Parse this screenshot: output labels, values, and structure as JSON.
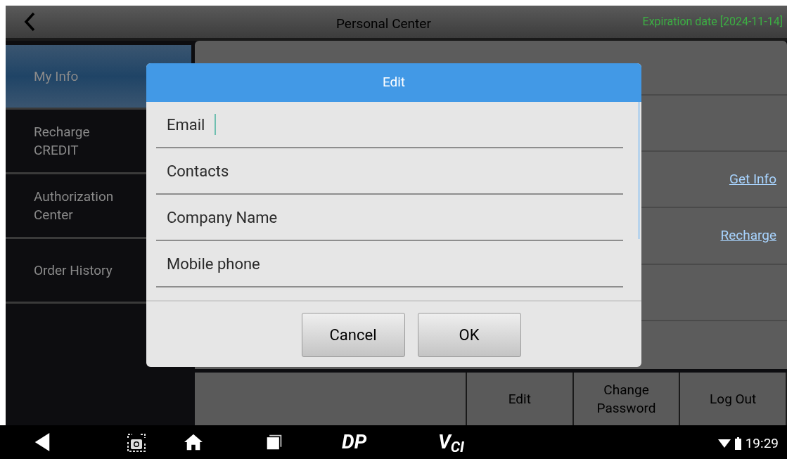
{
  "top_bar": {
    "title": "Personal Center",
    "expiration": "Expiration date [2024-11-14]"
  },
  "sidebar": {
    "items": [
      {
        "label": "My Info",
        "selected": true
      },
      {
        "label": "Recharge\nCREDIT",
        "selected": false
      },
      {
        "label": "Authorization\nCenter",
        "selected": false
      },
      {
        "label": "Order History",
        "selected": false
      }
    ]
  },
  "content": {
    "links": [
      {
        "label": "Get Info"
      },
      {
        "label": "Recharge"
      }
    ]
  },
  "bottom_buttons": [
    "Edit",
    "Change\nPassword",
    "Log Out"
  ],
  "dialog": {
    "title": "Edit",
    "fields": [
      {
        "label": "Email",
        "focused": true
      },
      {
        "label": "Contacts",
        "focused": false
      },
      {
        "label": "Company Name",
        "focused": false
      },
      {
        "label": "Mobile phone",
        "focused": false
      }
    ],
    "buttons": [
      "Cancel",
      "OK"
    ]
  },
  "nav_bar": {
    "items": [
      {
        "kind": "back"
      },
      {
        "kind": "screenshot"
      },
      {
        "kind": "home"
      },
      {
        "kind": "recents"
      },
      {
        "kind": "logo",
        "label": "DP"
      },
      {
        "kind": "logo",
        "label": "V$_{CI}$"
      }
    ],
    "time": "19:29"
  }
}
